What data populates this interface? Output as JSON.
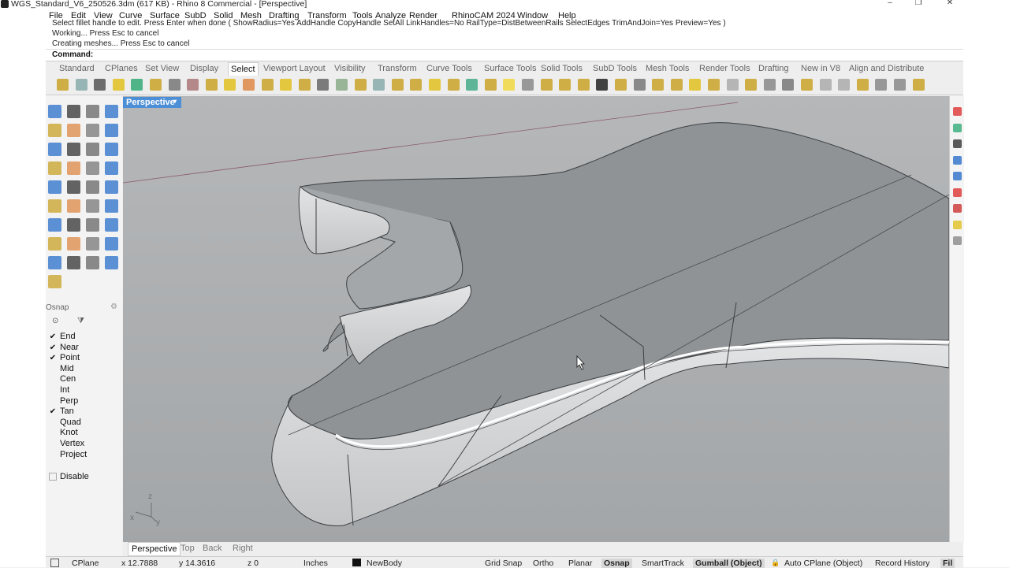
{
  "window": {
    "title": "WGS_Standard_V6_250526.3dm (617 KB) - Rhino 8 Commercial - [Perspective]",
    "minimize": "–",
    "maximize": "❐",
    "close": "✕"
  },
  "menu": [
    "File",
    "Edit",
    "View",
    "Curve",
    "Surface",
    "SubD",
    "Solid",
    "Mesh",
    "Drafting",
    "Transform",
    "Tools",
    "Analyze",
    "Render",
    "RhinoCAM 2024",
    "Window",
    "Help"
  ],
  "command": {
    "history": [
      "Select fillet handle to edit. Press Enter when done ( ShowRadius=Yes  AddHandle  CopyHandle  SetAll  LinkHandles=No  RailType=DistBetweenRails  SelectEdges  TrimAndJoin=Yes  Preview=Yes )",
      "Working... Press Esc to cancel",
      "Creating meshes... Press Esc to cancel"
    ],
    "prompt": "Command:"
  },
  "tabs": [
    "Standard",
    "CPlanes",
    "Set View",
    "Display",
    "Select",
    "Viewport Layout",
    "Visibility",
    "Transform",
    "Curve Tools",
    "Surface Tools",
    "Solid Tools",
    "SubD Tools",
    "Mesh Tools",
    "Render Tools",
    "Drafting",
    "New in V8",
    "Align and Distribute"
  ],
  "active_tab": "Select",
  "viewport": {
    "title": "Perspective",
    "axis_z": "z",
    "axis_x": "x",
    "axis_y": "y"
  },
  "osnap": {
    "header": "Osnap",
    "items": [
      {
        "label": "End",
        "checked": true
      },
      {
        "label": "Near",
        "checked": true
      },
      {
        "label": "Point",
        "checked": true
      },
      {
        "label": "Mid",
        "checked": false
      },
      {
        "label": "Cen",
        "checked": false
      },
      {
        "label": "Int",
        "checked": false
      },
      {
        "label": "Perp",
        "checked": false
      },
      {
        "label": "Tan",
        "checked": true
      },
      {
        "label": "Quad",
        "checked": false
      },
      {
        "label": "Knot",
        "checked": false
      },
      {
        "label": "Vertex",
        "checked": false
      },
      {
        "label": "Project",
        "checked": false
      }
    ],
    "disable": "Disable"
  },
  "viewport_tabs": [
    "Perspective",
    "Top",
    "Back",
    "Right"
  ],
  "status": {
    "cplane": "CPlane",
    "x": "x 12.7888",
    "y": "y 14.3616",
    "z": "z 0",
    "units": "Inches",
    "layer": "NewBody",
    "grid_snap": "Grid Snap",
    "ortho": "Ortho",
    "planar": "Planar",
    "osnap": "Osnap",
    "smarttrack": "SmartTrack",
    "gumball": "Gumball (Object)",
    "autocplane": "Auto CPlane (Object)",
    "record_history": "Record History",
    "filter": "Fil"
  },
  "colors": {
    "viewport_bg": "#a8abad",
    "viewport_title_bg": "#4d8fd6",
    "model_surface": "#8f9396"
  }
}
